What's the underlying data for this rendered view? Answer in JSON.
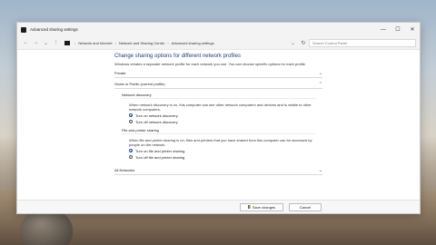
{
  "window": {
    "title": "Advanced sharing settings",
    "controls": {
      "minimize": "—",
      "maximize": "☐",
      "close": "✕"
    }
  },
  "address": {
    "nav": {
      "back": "←",
      "forward": "→",
      "up_dropdown": "⌄",
      "up": "↑"
    },
    "breadcrumbs": [
      "Network and Internet",
      "Network and Sharing Center",
      "Advanced sharing settings"
    ],
    "separator": "›",
    "dropdown": "⌄",
    "refresh": "↻",
    "search_placeholder": "Search Control Panel"
  },
  "main": {
    "title": "Change sharing options for different network profiles",
    "description": "Windows creates a separate network profile for each network you use. You can choose specific options for each profile.",
    "sections": {
      "private": {
        "label": "Private",
        "chevron": "⌄"
      },
      "guest": {
        "label": "Guest or Public (current profile)",
        "chevron": "⌃"
      },
      "all": {
        "label": "All Networks",
        "chevron": "⌄"
      }
    },
    "network_discovery": {
      "label": "Network discovery",
      "text": "When network discovery is on, this computer can see other network computers and devices and is visible to other network computers.",
      "options": [
        "Turn on network discovery",
        "Turn off network discovery"
      ],
      "selected": 0
    },
    "file_sharing": {
      "label": "File and printer sharing",
      "text": "When file and printer sharing is on, files and printers that you have shared from this computer can be accessed by people on the network.",
      "options": [
        "Turn on file and printer sharing",
        "Turn off file and printer sharing"
      ],
      "selected": 0
    }
  },
  "footer": {
    "save_label": "Save changes",
    "cancel_label": "Cancel"
  }
}
